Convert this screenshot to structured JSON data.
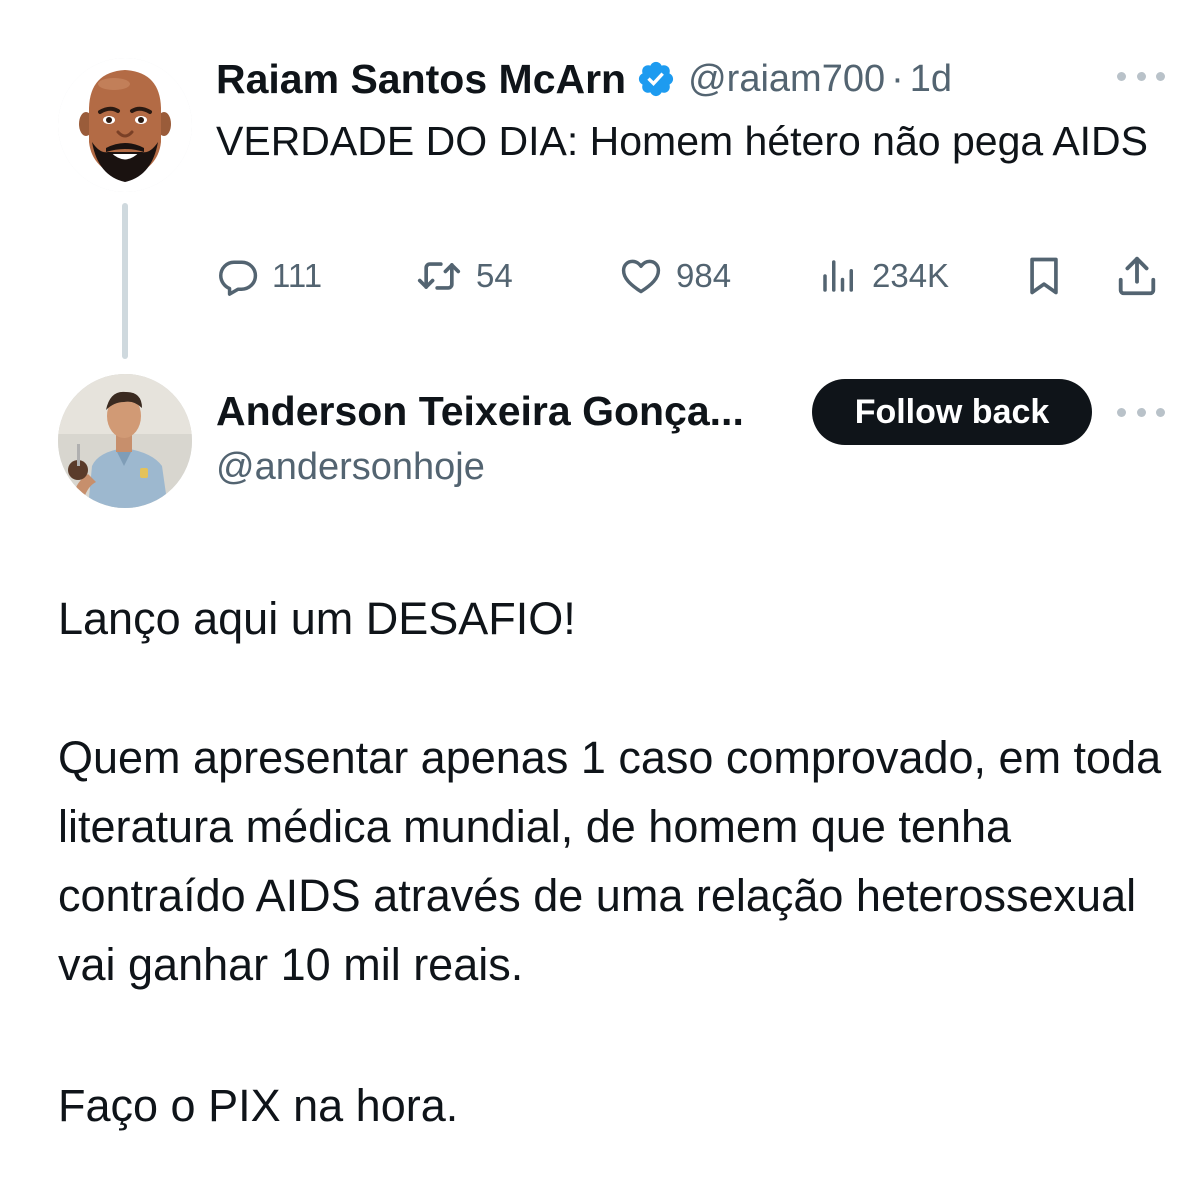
{
  "parent_tweet": {
    "author_name": "Raiam Santos McArn",
    "verified_icon": "verified-badge-icon",
    "handle": "@raiam700",
    "separator": "·",
    "time": "1d",
    "text": "VERDADE DO DIA: Homem hétero não pega AIDS",
    "stats": {
      "replies": "111",
      "retweets": "54",
      "likes": "984",
      "views": "234K"
    },
    "icons": [
      "reply-icon",
      "retweet-icon",
      "like-icon",
      "views-icon",
      "bookmark-icon",
      "share-icon",
      "more-icon"
    ]
  },
  "reply_tweet": {
    "author_name": "Anderson Teixeira Gonça...",
    "handle": "@andersonhoje",
    "follow_label": "Follow back",
    "paragraphs": [
      "Lanço aqui um DESAFIO!",
      "Quem apresentar apenas 1 caso comprovado, em toda literatura médica mundial, de homem que tenha contraído AIDS através de uma relação heterossexual vai ganhar 10 mil reais.",
      "Faço o PIX na hora."
    ]
  },
  "colors": {
    "text_primary": "#0f1419",
    "text_secondary": "#536471",
    "verified_blue": "#1d9bf0",
    "thread_line": "#cfd9de",
    "button_bg": "#0f1419"
  }
}
